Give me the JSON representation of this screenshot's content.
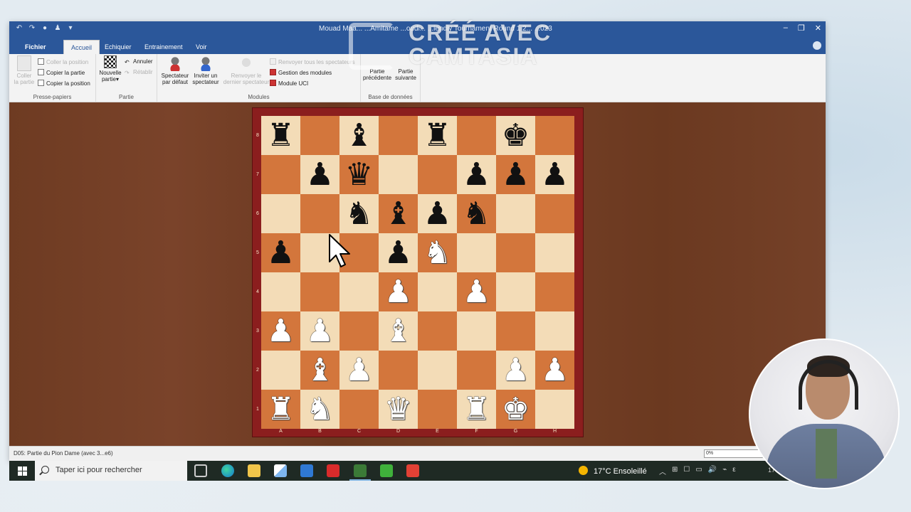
{
  "window": {
    "title": "Mouad Maa... ...Amitame ...oudi... ...iendly Tournament Round 1 2... ...023",
    "quick_access": [
      "↶",
      "↷",
      "●",
      "♟",
      "▾"
    ],
    "controls": [
      "–",
      "❐",
      "✕"
    ]
  },
  "tabs": [
    {
      "label": "Fichier"
    },
    {
      "label": "Accueil"
    },
    {
      "label": "Echiquier"
    },
    {
      "label": "Entrainement"
    },
    {
      "label": "Voir"
    }
  ],
  "ribbon": {
    "presse_papiers": {
      "label": "Presse-papiers",
      "coller_partie": "Coller\nla partie",
      "coller_position": "Coller la position",
      "copier_partie": "Copier la partie",
      "copier_position": "Copier la position"
    },
    "partie": {
      "label": "Partie",
      "nouvelle_partie": "Nouvelle\npartie▾",
      "annuler": "Annuler",
      "retablir": "Rétablir"
    },
    "modules": {
      "label": "Modules",
      "spectateur_defaut": "Spectateur\npar défaut",
      "inviter_spectateur": "Inviter un\nspectateur",
      "renvoyer_dernier": "Renvoyer le\ndernier spectateur",
      "renvoyer_tous": "Renvoyer tous les spectateurs",
      "gestion_modules": "Gestion des modules",
      "module_uci": "Module UCI"
    },
    "base_donnees": {
      "label": "Base de données",
      "partie_precedente": "Partie\nprécédente",
      "partie_suivante": "Partie\nsuivante"
    }
  },
  "board": {
    "files": [
      "A",
      "B",
      "C",
      "D",
      "E",
      "F",
      "G",
      "H"
    ],
    "ranks": [
      "8",
      "7",
      "6",
      "5",
      "4",
      "3",
      "2",
      "1"
    ],
    "position": [
      [
        "bR",
        "",
        "bB",
        "",
        "bR",
        "",
        "bK",
        ""
      ],
      [
        "",
        "bP",
        "bQ",
        "",
        "",
        "bP",
        "bP",
        "bP"
      ],
      [
        "",
        "",
        "bN",
        "bB",
        "bP",
        "bN",
        "",
        ""
      ],
      [
        "bP",
        "",
        "",
        "bP",
        "wN",
        "",
        "",
        ""
      ],
      [
        "",
        "",
        "",
        "wP",
        "",
        "wP",
        "",
        ""
      ],
      [
        "wP",
        "wP",
        "",
        "wB",
        "",
        "",
        "",
        ""
      ],
      [
        "",
        "wB",
        "wP",
        "",
        "",
        "",
        "wP",
        "wP"
      ],
      [
        "wR",
        "wN",
        "",
        "wQ",
        "",
        "wR",
        "wK",
        ""
      ]
    ]
  },
  "status": {
    "opening": "D05: Partie du Pion Dame (avec 3...e6)",
    "progress": "0%"
  },
  "taskbar": {
    "search_placeholder": "Taper ici pour rechercher",
    "weather": "17°C  Ensoleillé",
    "tray": [
      "︿",
      "⊞",
      "☐",
      "▭",
      "🔊",
      "⌁",
      "ε"
    ],
    "clock": "17-0"
  },
  "watermark": {
    "line1": "CRÉÉ AVEC",
    "line2": "CAMTASIA"
  }
}
